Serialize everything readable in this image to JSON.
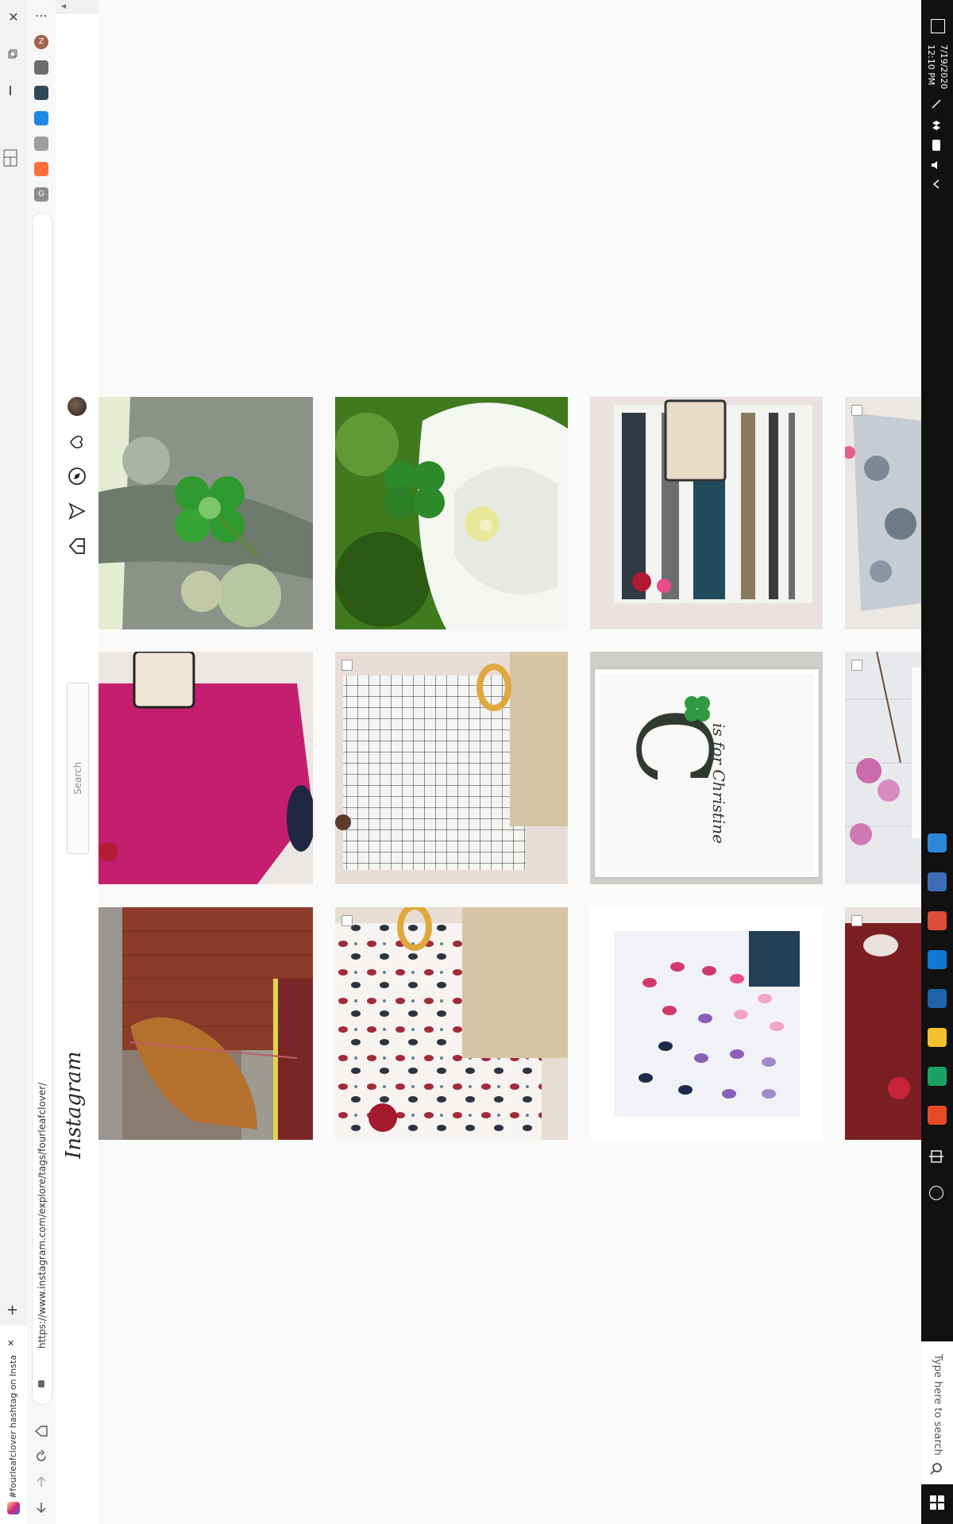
{
  "browser": {
    "tab_title": "#fourleafclover hashtag on Insta...",
    "url": "https://www.instagram.com/explore/tags/fourleafclover/",
    "new_tab_symbol": "+",
    "close_symbol": "✕",
    "more_symbol": "⋯"
  },
  "extensions": [
    {
      "name": "profile",
      "color": "#a0634a",
      "letter": "Z"
    },
    {
      "name": "puzzle",
      "color": "#6e6e6e",
      "letter": ""
    },
    {
      "name": "image-ext",
      "color": "#2f4a5b",
      "letter": ""
    },
    {
      "name": "blue-ext",
      "color": "#1e88e5",
      "letter": ""
    },
    {
      "name": "circle-ext",
      "color": "#9e9e9e",
      "letter": ""
    },
    {
      "name": "orange-ext",
      "color": "#ff6f3c",
      "letter": ""
    },
    {
      "name": "g-ext",
      "color": "#8d8d8d",
      "letter": "G"
    }
  ],
  "instagram": {
    "logo": "Instagram",
    "search_placeholder": "Search"
  },
  "grid": {
    "columns": 4,
    "tiles": [
      {
        "id": "t1",
        "subject": "four-leaf clover on lichen branch",
        "checkbox": false
      },
      {
        "id": "t2",
        "subject": "clover with white morning glory flower",
        "checkbox": false
      },
      {
        "id": "t3",
        "subject": "striped dress with cream handbag",
        "checkbox": false
      },
      {
        "id": "t4",
        "subject": "grey floral dress",
        "checkbox": true
      },
      {
        "id": "t5",
        "subject": "magenta dress with handbag and shoes",
        "checkbox": false
      },
      {
        "id": "t6",
        "subject": "checked dress with wooden bag",
        "checkbox": true
      },
      {
        "id": "t7",
        "subject": "framed print letter C",
        "checkbox": false
      },
      {
        "id": "t8",
        "subject": "pink orchids on white wood",
        "checkbox": true
      },
      {
        "id": "t9",
        "subject": "golden retriever by brick wall",
        "checkbox": false
      },
      {
        "id": "t10",
        "subject": "paisley print dress",
        "checkbox": true
      },
      {
        "id": "t11",
        "subject": "white shirt with lip prints",
        "checkbox": false
      },
      {
        "id": "t12",
        "subject": "burgundy dress",
        "checkbox": true
      }
    ]
  },
  "print_text": {
    "letter": "C",
    "caption": "is for Christine"
  },
  "taskbar": {
    "time": "12:10 PM",
    "date": "7/19/2020",
    "search_placeholder": "Type here to search",
    "apps": [
      {
        "name": "calendar-app",
        "color": "#2b88d8"
      },
      {
        "name": "settings-app",
        "color": "#3c6db5"
      },
      {
        "name": "chrome-app",
        "color": "#dd4b39"
      },
      {
        "name": "outlook-app",
        "color": "#0f78d4"
      },
      {
        "name": "photoshop-app",
        "color": "#1f63a8"
      },
      {
        "name": "files-app",
        "color": "#f2c12e"
      },
      {
        "name": "edge-app",
        "color": "#1ba262"
      },
      {
        "name": "office-app",
        "color": "#e84a25"
      }
    ]
  }
}
